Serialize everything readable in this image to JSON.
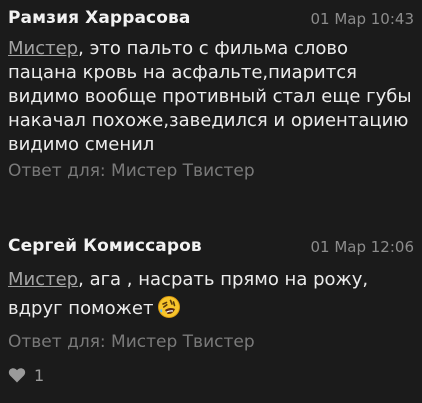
{
  "comments": [
    {
      "author": "Рамзия Харрасова",
      "time": "01 Мар 10:43",
      "mention": "Мистер",
      "text": ", это пальто с фильма слово пацана кровь на асфальте,пиарится видимо вообще противный стал еще губы накачал похоже,заведился и ориентацию видимо сменил",
      "reply_to": "Ответ для: Мистер Твистер"
    },
    {
      "author": "Сергей Комиссаров",
      "time": "01 Мар 12:06",
      "mention": "Мистер",
      "text": ", ага , насрать прямо на рожу, вдруг поможет",
      "emoji": "rolling-on-floor-laughing",
      "reply_to": "Ответ для: Мистер Твистер",
      "likes": "1",
      "like_icon": "heart-icon"
    }
  ]
}
